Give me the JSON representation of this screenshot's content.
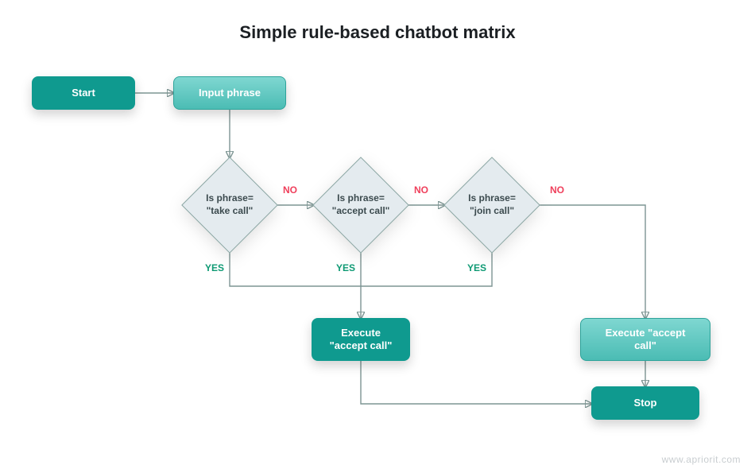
{
  "title": "Simple rule-based chatbot matrix",
  "nodes": {
    "start": {
      "label": "Start"
    },
    "input": {
      "label": "Input phrase"
    },
    "d1": {
      "label": "Is phrase=\n\"take call\""
    },
    "d2": {
      "label": "Is phrase=\n\"accept call\""
    },
    "d3": {
      "label": "Is phrase=\n\"join call\""
    },
    "exec_yes": {
      "label": "Execute\n\"accept call\""
    },
    "exec_no": {
      "label": "Execute \"accept call\""
    },
    "stop": {
      "label": "Stop"
    }
  },
  "labels": {
    "no": "NO",
    "yes": "YES"
  },
  "colors": {
    "teal": "#0f9a8f",
    "teal_light": "#5cc4bd",
    "diamond_fill": "#e4ebef",
    "arrow": "#7d9593",
    "no": "#ef3f5b",
    "yes": "#0f9a74"
  },
  "watermark": "www.apriorit.com",
  "flow": {
    "description": "Rule-based chatbot decision flowchart. Start → Input phrase → three sequential equality checks (take call, accept call, join call). Any YES leads to Execute \"accept call\" then Stop. If all three are NO, it also leads to an Execute \"accept call\" box (right side) then Stop.",
    "edges": [
      {
        "from": "start",
        "to": "input",
        "label": null
      },
      {
        "from": "input",
        "to": "d1",
        "label": null
      },
      {
        "from": "d1",
        "to": "d2",
        "label": "NO"
      },
      {
        "from": "d2",
        "to": "d3",
        "label": "NO"
      },
      {
        "from": "d3",
        "to": "exec_no",
        "label": "NO"
      },
      {
        "from": "d1",
        "to": "exec_yes",
        "label": "YES"
      },
      {
        "from": "d2",
        "to": "exec_yes",
        "label": "YES"
      },
      {
        "from": "d3",
        "to": "exec_yes",
        "label": "YES"
      },
      {
        "from": "exec_yes",
        "to": "stop",
        "label": null
      },
      {
        "from": "exec_no",
        "to": "stop",
        "label": null
      }
    ]
  }
}
